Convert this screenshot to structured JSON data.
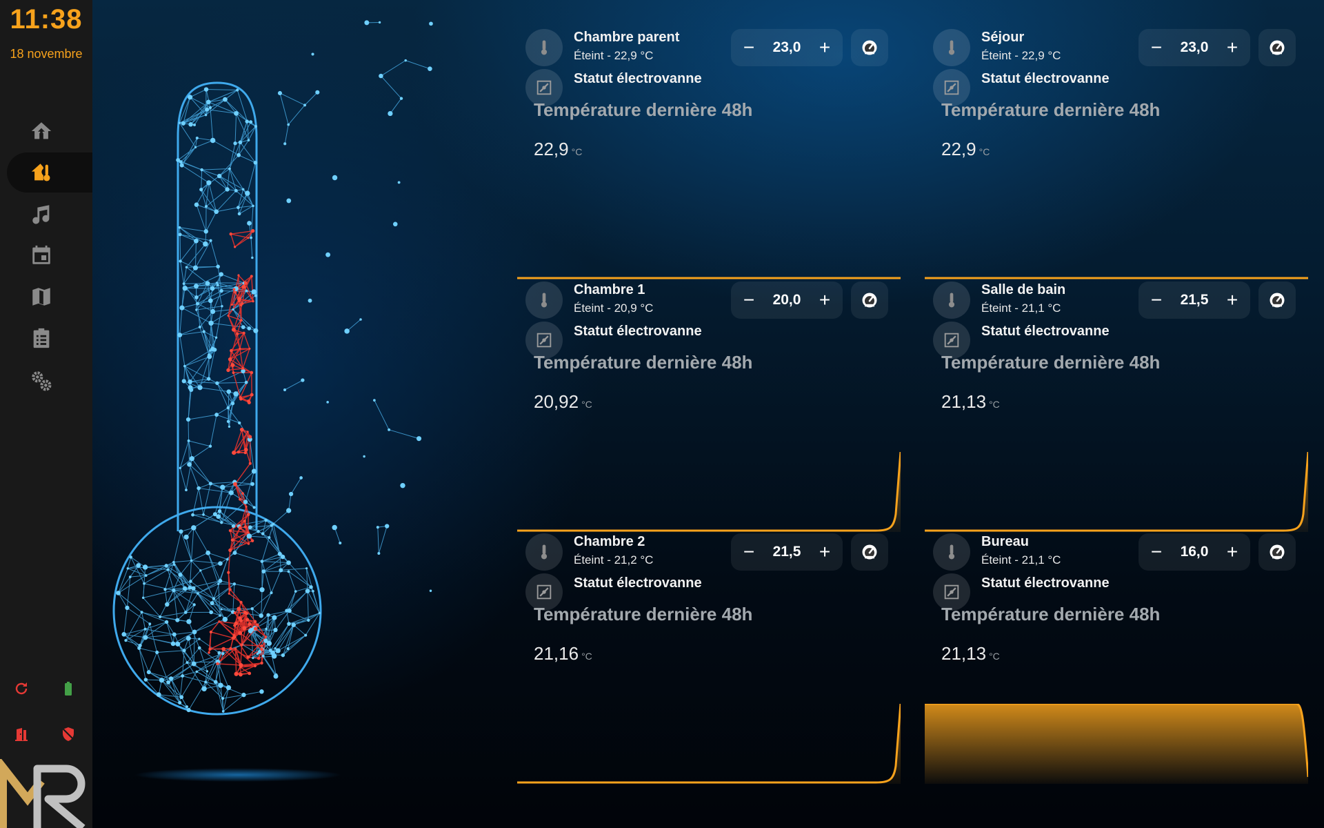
{
  "sidebar": {
    "time": "11:38",
    "date": "18 novembre",
    "nav": [
      {
        "icon": "home-upload-icon"
      },
      {
        "icon": "home-thermometer-icon",
        "active": true
      },
      {
        "icon": "music-note-icon"
      },
      {
        "icon": "calendar-icon"
      },
      {
        "icon": "map-icon"
      },
      {
        "icon": "clipboard-list-icon"
      },
      {
        "icon": "cogs-icon"
      }
    ],
    "status_icons": [
      "refresh-icon",
      "battery-icon",
      "door-open-icon",
      "shield-off-icon"
    ],
    "logo_icon": "mr-logo-icon"
  },
  "colors": {
    "accent": "#f7a21c",
    "sidebar_bg": "#191919",
    "status_red": "#e53935",
    "status_green": "#43a047",
    "graph_line": "#f7a21c"
  },
  "labels": {
    "valve": "Statut électrovanne",
    "graph_title": "Température dernière 48h",
    "unit": "°C"
  },
  "rooms": [
    {
      "name": "Chambre parent",
      "state": "Éteint - 22,9 °C",
      "setpoint": "23,0",
      "graph_value": "22,9",
      "trend": "flat"
    },
    {
      "name": "Séjour",
      "state": "Éteint - 22,9 °C",
      "setpoint": "23,0",
      "graph_value": "22,9",
      "trend": "flat"
    },
    {
      "name": "Chambre 1",
      "state": "Éteint - 20,9 °C",
      "setpoint": "20,0",
      "graph_value": "20,92",
      "trend": "spike-end"
    },
    {
      "name": "Salle de bain",
      "state": "Éteint - 21,1 °C",
      "setpoint": "21,5",
      "graph_value": "21,13",
      "trend": "spike-end"
    },
    {
      "name": "Chambre 2",
      "state": "Éteint - 21,2 °C",
      "setpoint": "21,5",
      "graph_value": "21,16",
      "trend": "spike-end"
    },
    {
      "name": "Bureau",
      "state": "Éteint - 21,1 °C",
      "setpoint": "16,0",
      "graph_value": "21,13",
      "trend": "plateau"
    }
  ],
  "controls": {
    "minus": "−",
    "plus": "+"
  }
}
